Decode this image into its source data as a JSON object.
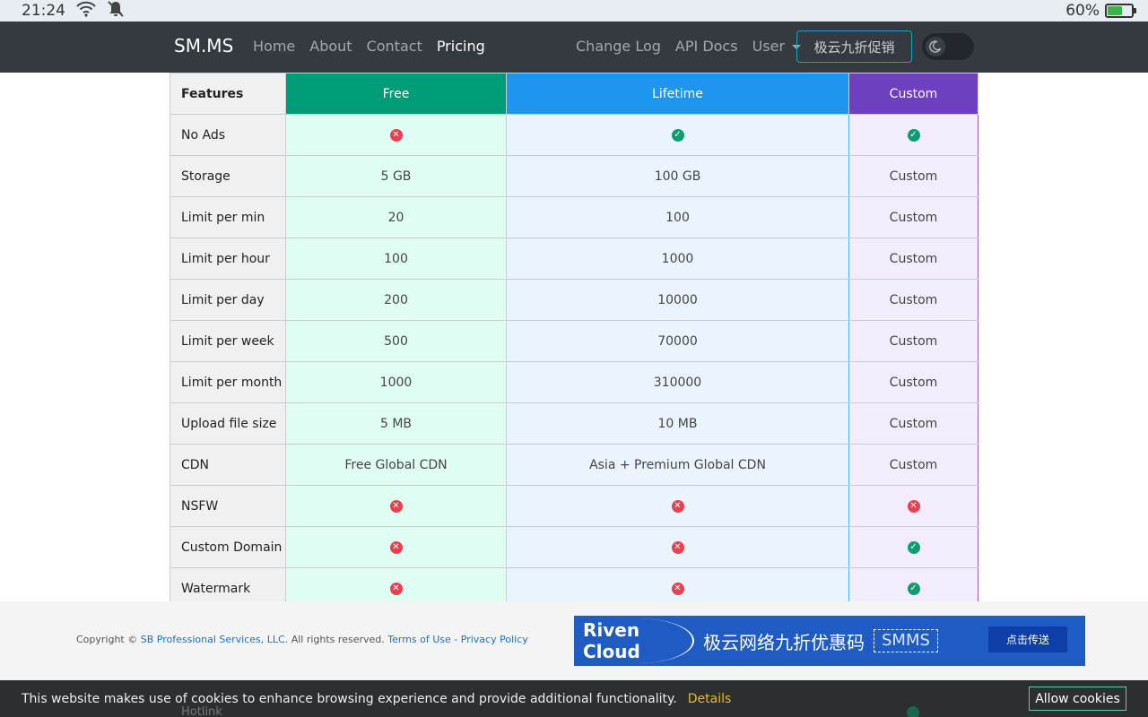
{
  "statusbar": {
    "time": "21:24",
    "battery": "60%",
    "battery_level": 0.6,
    "wifi_icon": "wifi-icon",
    "notification_icon": "bell-off-icon"
  },
  "navbar": {
    "brand": "SM.MS",
    "left_items": [
      {
        "label": "Home"
      },
      {
        "label": "About"
      },
      {
        "label": "Contact"
      },
      {
        "label": "Pricing",
        "active": true
      }
    ],
    "right_items": [
      {
        "label": "Change Log"
      },
      {
        "label": "API Docs"
      },
      {
        "label": "User"
      }
    ],
    "promo_button": "极云九折促销",
    "theme_icon": "moon-icon"
  },
  "table": {
    "headers": [
      "Features",
      "Free",
      "Lifetime",
      "Custom"
    ],
    "header_colors": {
      "free": "#009b77",
      "lifetime": "#1e96f0",
      "custom": "#6f3fc2"
    },
    "rows": [
      {
        "feature": "No Ads",
        "free": "x",
        "lifetime": "check",
        "custom": "check"
      },
      {
        "feature": "Storage",
        "free": "5 GB",
        "lifetime": "100 GB",
        "custom": "Custom"
      },
      {
        "feature": "Limit per min",
        "free": "20",
        "lifetime": "100",
        "custom": "Custom"
      },
      {
        "feature": "Limit per hour",
        "free": "100",
        "lifetime": "1000",
        "custom": "Custom"
      },
      {
        "feature": "Limit per day",
        "free": "200",
        "lifetime": "10000",
        "custom": "Custom"
      },
      {
        "feature": "Limit per week",
        "free": "500",
        "lifetime": "70000",
        "custom": "Custom"
      },
      {
        "feature": "Limit per month",
        "free": "1000",
        "lifetime": "310000",
        "custom": "Custom"
      },
      {
        "feature": "Upload file size",
        "free": "5 MB",
        "lifetime": "10 MB",
        "custom": "Custom"
      },
      {
        "feature": "CDN",
        "free": "Free Global CDN",
        "lifetime": "Asia + Premium Global CDN",
        "custom": "Custom"
      },
      {
        "feature": "NSFW",
        "free": "x",
        "lifetime": "x",
        "custom": "x"
      },
      {
        "feature": "Custom Domain",
        "free": "x",
        "lifetime": "x",
        "custom": "check"
      },
      {
        "feature": "Watermark",
        "free": "x",
        "lifetime": "x",
        "custom": "check"
      }
    ]
  },
  "footer": {
    "copyright_prefix": "Copyright ©",
    "company": "SB Professional Services, LLC.",
    "rights": "All rights reserved.",
    "terms": "Terms of Use",
    "separator": "-",
    "privacy": "Privacy Policy"
  },
  "ad": {
    "brand": "Riven Cloud",
    "text": "极云网络九折优惠码",
    "code": "SMMS",
    "button": "点击传送"
  },
  "cookie": {
    "message": "This website makes use of cookies to enhance browsing experience and provide additional functionality.",
    "details": "Details",
    "button": "Allow cookies",
    "peek_row": "Hotlink"
  }
}
